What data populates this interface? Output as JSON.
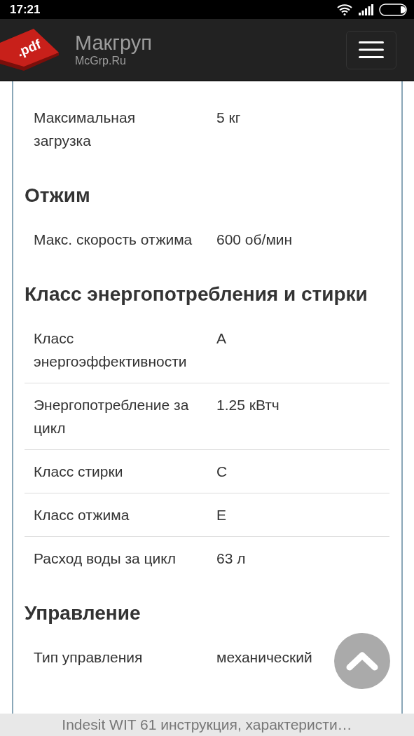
{
  "status_bar": {
    "time": "17:21"
  },
  "navbar": {
    "logo_label": ".pdf",
    "brand": "Макгруп",
    "subtitle": "McGrp.Ru"
  },
  "sections": [
    {
      "rows": [
        {
          "label": "Максимальная загрузка",
          "value": "5 кг"
        }
      ]
    },
    {
      "title": "Отжим",
      "rows": [
        {
          "label": "Макс. скорость отжима",
          "value": "600 об/мин"
        }
      ]
    },
    {
      "title": "Класс энергопотребления и стирки",
      "rows": [
        {
          "label": "Класс энергоэффективности",
          "value": "A"
        },
        {
          "label": "Энергопотребление за цикл",
          "value": "1.25 кВтч"
        },
        {
          "label": "Класс стирки",
          "value": "C"
        },
        {
          "label": "Класс отжима",
          "value": "E"
        },
        {
          "label": "Расход воды за цикл",
          "value": "63 л"
        }
      ]
    },
    {
      "title": "Управление",
      "rows": [
        {
          "label": "Тип управления",
          "value": "механический"
        }
      ]
    }
  ],
  "footer": {
    "title": "Indesit WIT 61 инструкция, характеристи…"
  }
}
